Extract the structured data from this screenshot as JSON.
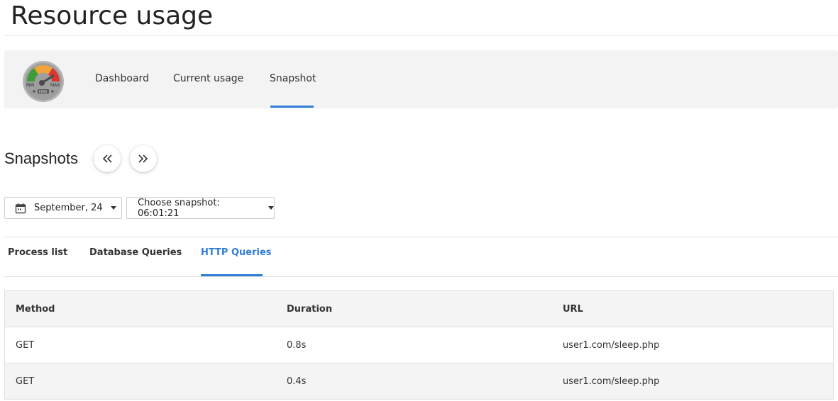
{
  "page": {
    "title": "Resource usage"
  },
  "nav": {
    "tabs": [
      {
        "label": "Dashboard"
      },
      {
        "label": "Current usage"
      },
      {
        "label": "Snapshot"
      }
    ],
    "active_tab": "Snapshot",
    "logo": {
      "icon": "gauge-logo-icon",
      "min_label": "MIN",
      "max_label": "MAX"
    }
  },
  "snapshots": {
    "title": "Snapshots",
    "prev_icon": "chevrons-left-icon",
    "next_icon": "chevrons-right-icon",
    "date_picker": {
      "icon": "calendar-icon",
      "value": "September, 24"
    },
    "snapshot_picker": {
      "value": "Choose snapshot: 06:01:21"
    }
  },
  "sub_tabs": {
    "tabs": [
      {
        "label": "Process list"
      },
      {
        "label": "Database Queries"
      },
      {
        "label": "HTTP Queries"
      }
    ],
    "active_tab": "HTTP Queries"
  },
  "table": {
    "columns": [
      "Method",
      "Duration",
      "URL"
    ],
    "rows": [
      [
        "GET",
        "0.8s",
        "user1.com/sleep.php"
      ],
      [
        "GET",
        "0.4s",
        "user1.com/sleep.php"
      ]
    ]
  },
  "colors": {
    "accent": "#2f7ed8",
    "panel_bg": "#f3f3f3"
  }
}
